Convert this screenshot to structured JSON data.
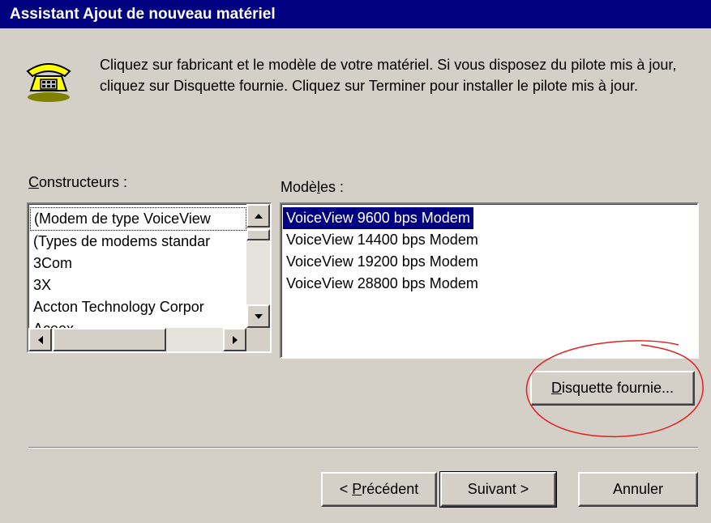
{
  "window": {
    "title": "Assistant Ajout de nouveau matériel"
  },
  "description": "Cliquez sur fabricant et le modèle de votre matériel. Si vous disposez du pilote mis à jour, cliquez sur Disquette fournie. Cliquez sur Terminer pour installer le pilote mis à jour.",
  "manufacturers": {
    "label_accel": "C",
    "label_rest": "onstructeurs :",
    "items": [
      "(Modem de type VoiceView",
      "(Types de modems standar",
      "3Com",
      "3X",
      "Accton Technology Corpor",
      "Aceex"
    ]
  },
  "models": {
    "label_pre": "Modè",
    "label_accel": "l",
    "label_post": "es :",
    "items": [
      "VoiceView  9600 bps Modem",
      "VoiceView 14400 bps Modem",
      "VoiceView 19200 bps Modem",
      "VoiceView 28800 bps Modem"
    ]
  },
  "buttons": {
    "have_disk_accel": "D",
    "have_disk_rest": "isquette fournie...",
    "back_pre": "< ",
    "back_accel": "P",
    "back_rest": "récédent",
    "next": "Suivant >",
    "cancel": "Annuler"
  },
  "colors": {
    "selection": "#000080",
    "annotation": "#e02020"
  }
}
